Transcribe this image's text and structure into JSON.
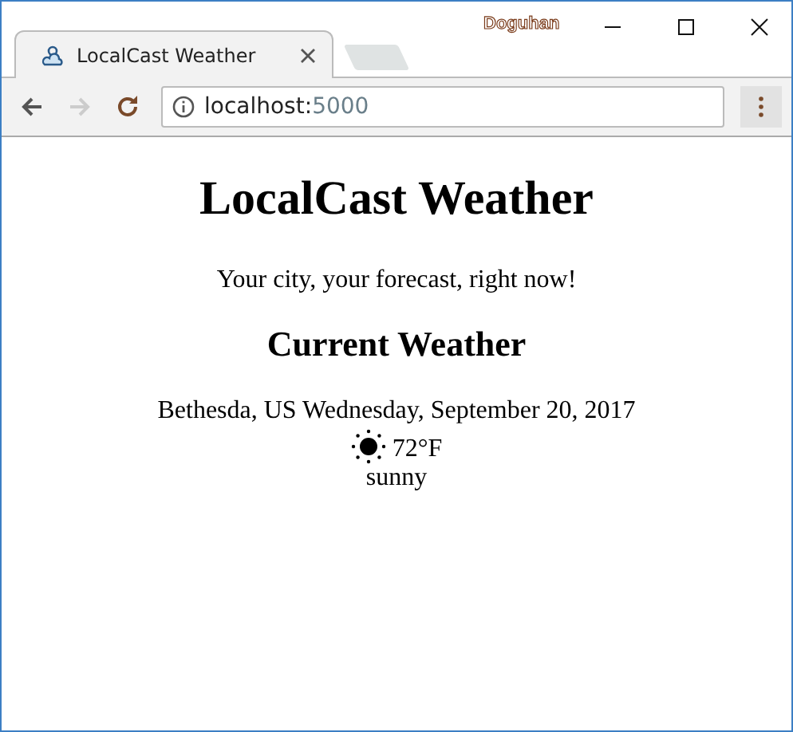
{
  "window": {
    "profile_name": "Doguhan"
  },
  "tabs": [
    {
      "title": "LocalCast Weather",
      "selected": true
    }
  ],
  "toolbar": {
    "forward_disabled": true,
    "address": {
      "host": "localhost:",
      "port": "5000"
    }
  },
  "page": {
    "title": "LocalCast Weather",
    "tagline": "Your city, your forecast, right now!",
    "section_title": "Current Weather",
    "location": "Bethesda, US",
    "date": "Wednesday, September 20, 2017",
    "temperature": "72°F",
    "condition": "sunny"
  }
}
